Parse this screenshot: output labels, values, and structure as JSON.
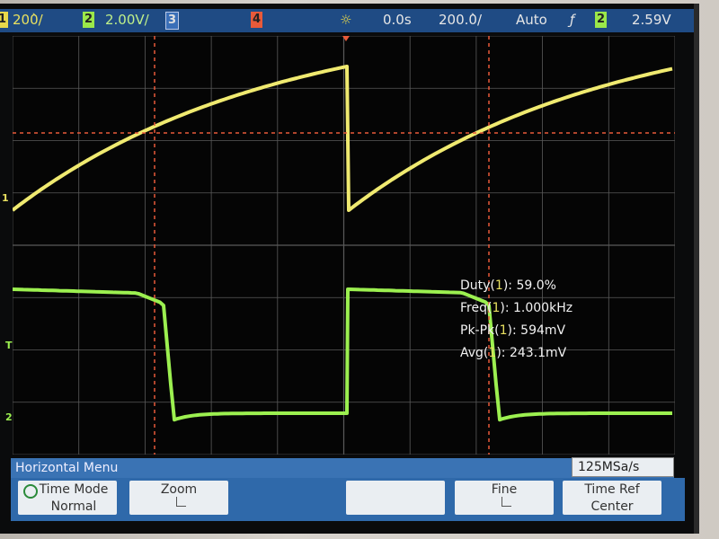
{
  "status": {
    "ch1_num": "1",
    "ch1_scale": "200̀/",
    "ch2_num": "2",
    "ch2_scale": "2.00V/",
    "ch3_num": "3",
    "ch4_num": "4",
    "delay": "0.0s",
    "timebase": "200.0̀/",
    "mode": "Auto",
    "trigger_icon": "rising-edge-icon",
    "trigger_channel": "2",
    "trigger_level": "2.59V"
  },
  "markers": {
    "ch1": "1",
    "trig": "T",
    "ch2": "2"
  },
  "measurements": [
    {
      "label": "Duty(",
      "ch": "1",
      "rest": "): 59.0%"
    },
    {
      "label": "Freq(",
      "ch": "1",
      "rest": "): 1.000kHz"
    },
    {
      "label": "Pk-Pk(",
      "ch": "1",
      "rest": "): 594mV"
    },
    {
      "label": "Avg(",
      "ch": "1",
      "rest": "): 243.1mV"
    }
  ],
  "menu": {
    "title": "Horizontal Menu",
    "sample_rate": "125MSa/s",
    "softkeys": [
      {
        "line1": "Time Mode",
        "line2": "Normal"
      },
      {
        "line1": "Zoom",
        "line2": ""
      },
      {
        "line1": "",
        "line2": ""
      },
      {
        "line1": "Fine",
        "line2": ""
      },
      {
        "line1": "Time Ref",
        "line2": "Center"
      }
    ]
  },
  "colors": {
    "ch1": "#f0ea70",
    "ch2": "#9cf050",
    "cursor": "#e85a3a",
    "graticule": "#5a5a5a",
    "statusbar": "#1f4b84"
  }
}
